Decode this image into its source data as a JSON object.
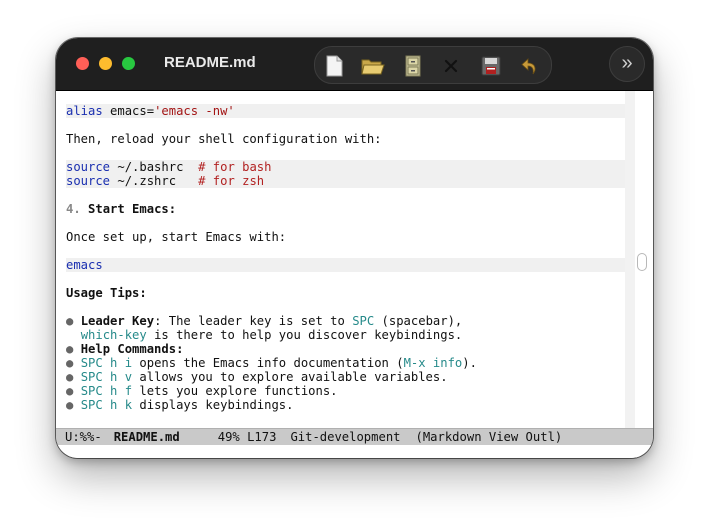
{
  "window": {
    "title": "README.md"
  },
  "toolbar": {
    "items": [
      "new-file-icon",
      "open-folder-icon",
      "cabinet-icon",
      "close-x-icon",
      "save-disk-icon",
      "undo-icon"
    ],
    "more_label": "»"
  },
  "editor": {
    "lines": [
      {
        "type": "code",
        "parts": [
          {
            "c": "kw",
            "t": "alias"
          },
          {
            "c": "",
            "t": " emacs="
          },
          {
            "c": "str",
            "t": "'emacs -nw'"
          }
        ]
      },
      {
        "type": "blank",
        "parts": []
      },
      {
        "type": "text",
        "parts": [
          {
            "c": "",
            "t": "Then, reload your shell configuration with:"
          }
        ]
      },
      {
        "type": "blank",
        "parts": []
      },
      {
        "type": "code",
        "parts": [
          {
            "c": "kw",
            "t": "source"
          },
          {
            "c": "",
            "t": " ~/.bashrc  "
          },
          {
            "c": "cmt",
            "t": "# for bash"
          }
        ]
      },
      {
        "type": "code",
        "parts": [
          {
            "c": "kw",
            "t": "source"
          },
          {
            "c": "",
            "t": " ~/.zshrc   "
          },
          {
            "c": "cmt",
            "t": "# for zsh"
          }
        ]
      },
      {
        "type": "blank",
        "parts": []
      },
      {
        "type": "text",
        "parts": [
          {
            "c": "num",
            "t": "4."
          },
          {
            "c": "",
            "t": " "
          },
          {
            "c": "bold",
            "t": "Start Emacs:"
          }
        ]
      },
      {
        "type": "blank",
        "parts": []
      },
      {
        "type": "text",
        "parts": [
          {
            "c": "",
            "t": "Once set up, start Emacs with:"
          }
        ]
      },
      {
        "type": "blank",
        "parts": []
      },
      {
        "type": "code",
        "parts": [
          {
            "c": "kw",
            "t": "emacs"
          }
        ]
      },
      {
        "type": "blank",
        "parts": []
      },
      {
        "type": "text",
        "parts": [
          {
            "c": "bold",
            "t": "Usage Tips:"
          }
        ]
      },
      {
        "type": "blank",
        "parts": []
      },
      {
        "type": "text",
        "parts": [
          {
            "c": "bullet",
            "t": "● "
          },
          {
            "c": "bold",
            "t": "Leader Key"
          },
          {
            "c": "",
            "t": ": The leader key is set to "
          },
          {
            "c": "teal",
            "t": "SPC"
          },
          {
            "c": "",
            "t": " (spacebar),"
          }
        ]
      },
      {
        "type": "text",
        "parts": [
          {
            "c": "",
            "t": "  "
          },
          {
            "c": "teal",
            "t": "which-key"
          },
          {
            "c": "",
            "t": " is there to help you discover keybindings."
          }
        ]
      },
      {
        "type": "text",
        "parts": [
          {
            "c": "bullet",
            "t": "● "
          },
          {
            "c": "bold",
            "t": "Help Commands:"
          }
        ]
      },
      {
        "type": "text",
        "parts": [
          {
            "c": "bullet",
            "t": "● "
          },
          {
            "c": "teal",
            "t": "SPC h i"
          },
          {
            "c": "",
            "t": " opens the Emacs info documentation ("
          },
          {
            "c": "teal",
            "t": "M-x info"
          },
          {
            "c": "",
            "t": ")."
          }
        ]
      },
      {
        "type": "text",
        "parts": [
          {
            "c": "bullet",
            "t": "● "
          },
          {
            "c": "teal",
            "t": "SPC h v"
          },
          {
            "c": "",
            "t": " allows you to explore available variables."
          }
        ]
      },
      {
        "type": "text",
        "parts": [
          {
            "c": "bullet",
            "t": "● "
          },
          {
            "c": "teal",
            "t": "SPC h f"
          },
          {
            "c": "",
            "t": " lets you explore functions."
          }
        ]
      },
      {
        "type": "text",
        "parts": [
          {
            "c": "bullet",
            "t": "● "
          },
          {
            "c": "teal",
            "t": "SPC h k"
          },
          {
            "c": "",
            "t": " displays keybindings."
          }
        ]
      }
    ]
  },
  "modeline": {
    "status": "U:%%-",
    "buffer": "README.md",
    "position": "49% L173",
    "vc": "Git-development",
    "mode": "(Markdown View Outl)"
  }
}
